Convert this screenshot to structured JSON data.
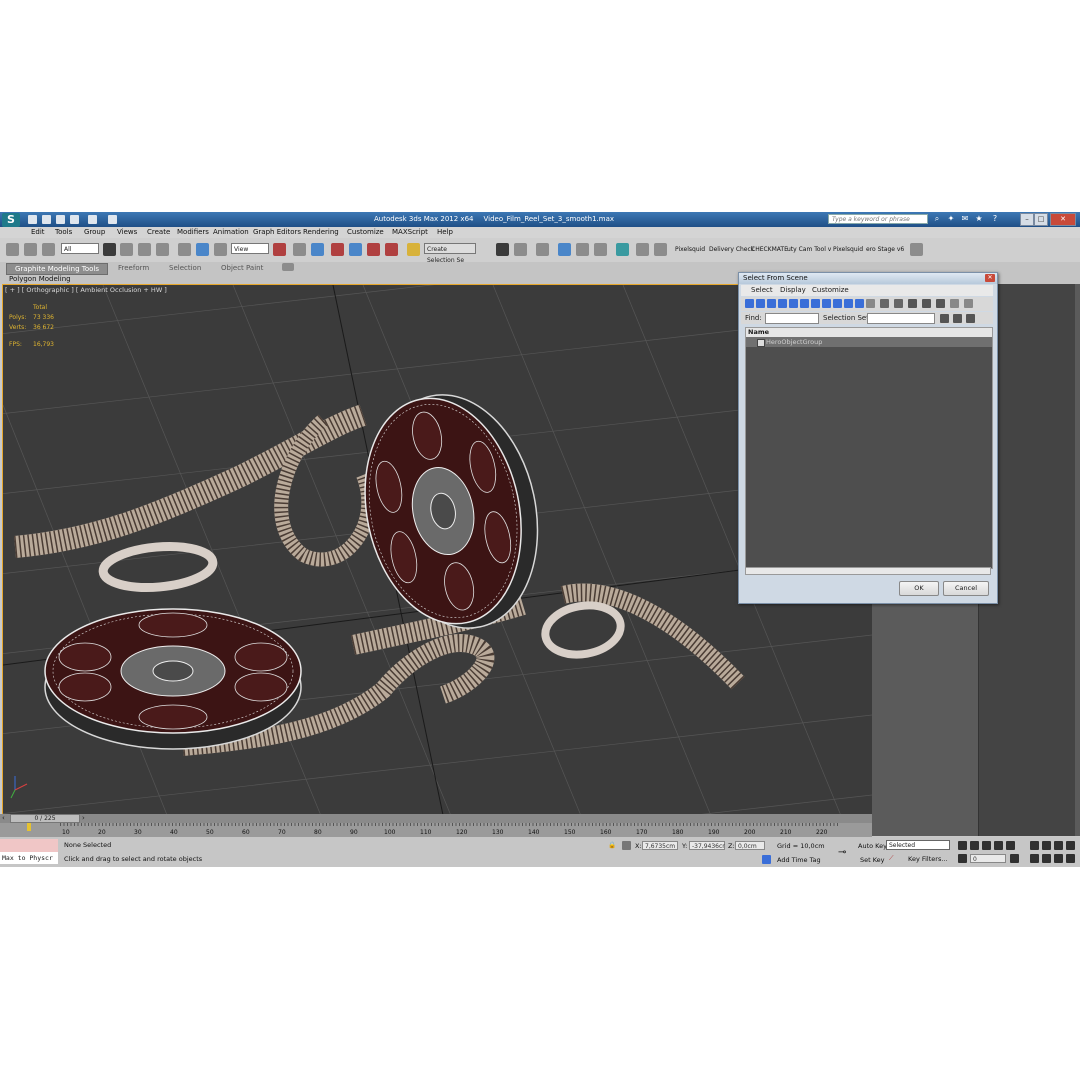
{
  "window": {
    "app_title": "Autodesk 3ds Max  2012 x64",
    "doc_title": "Video_Film_Reel_Set_3_smooth1.max",
    "search_placeholder": "Type a keyword or phrase"
  },
  "menu": [
    "Edit",
    "Tools",
    "Group",
    "Views",
    "Create",
    "Modifiers",
    "Animation",
    "Graph Editors",
    "Rendering",
    "Customize",
    "MAXScript",
    "Help"
  ],
  "toolbar": {
    "filter_value": "All",
    "reference_coord": "View",
    "named_selection": "Create Selection Se",
    "scripts": [
      "Pixelsquid",
      "Delivery Check",
      "CHECKMATE",
      "uty Cam Tool v",
      "Pixelsquid",
      "ero Stage v6"
    ]
  },
  "ribbon": {
    "tabs": [
      "Graphite Modeling Tools",
      "Freeform",
      "Selection",
      "Object Paint"
    ],
    "panel_label": "Polygon Modeling"
  },
  "viewport": {
    "label": "[ + ] [ Orthographic ] [ Ambient Occlusion + HW ]",
    "stats": {
      "header": "Total",
      "polys_label": "Polys:",
      "polys_value": "73 336",
      "verts_label": "Verts:",
      "verts_value": "36 672",
      "fps_label": "FPS:",
      "fps_value": "16,793"
    }
  },
  "dialog": {
    "title": "Select From Scene",
    "menu": [
      "Select",
      "Display",
      "Customize"
    ],
    "find_label": "Find:",
    "selection_set_label": "Selection Set:",
    "column_name": "Name",
    "items": [
      "HeroObjectGroup"
    ],
    "ok_label": "OK",
    "cancel_label": "Cancel"
  },
  "timeline": {
    "frame_counter": "0 / 225",
    "ticks": [
      "10",
      "20",
      "30",
      "40",
      "50",
      "60",
      "70",
      "80",
      "90",
      "100",
      "110",
      "120",
      "130",
      "140",
      "150",
      "160",
      "170",
      "180",
      "190",
      "200",
      "210",
      "220"
    ]
  },
  "status": {
    "listener_text": "Max to Physcr",
    "selection_text": "None Selected",
    "prompt_text": "Click and drag to select and rotate objects",
    "x_label": "X:",
    "x_value": "7,6735cm",
    "y_label": "Y:",
    "y_value": "-37,9436cr",
    "z_label": "Z:",
    "z_value": "0,0cm",
    "grid": "Grid = 10,0cm",
    "add_time_tag": "Add Time Tag",
    "auto_key": "Auto Key",
    "set_key": "Set Key",
    "key_mode": "Selected",
    "key_filters": "Key Filters...",
    "current_frame": "0"
  },
  "colors": {
    "accent": "#1f4f86",
    "viewport_bg": "#3b3b3b",
    "viewport_border": "#e6a62a",
    "stats": "#e0b530"
  }
}
